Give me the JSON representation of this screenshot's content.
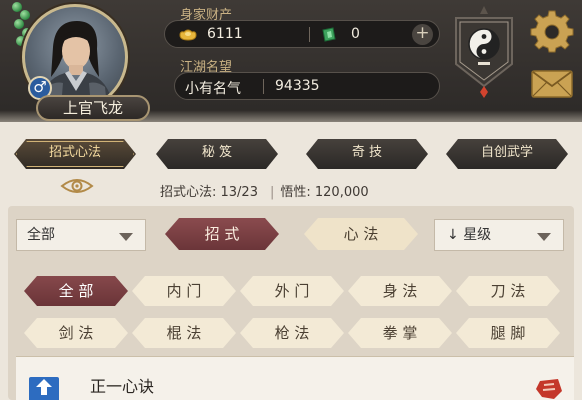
{
  "player": {
    "name": "上官飞龙",
    "gender_symbol": "♂"
  },
  "wealth": {
    "label": "身家财产",
    "gold": "6111",
    "jade": "0"
  },
  "fame": {
    "label": "江湖名望",
    "title": "小有名气",
    "value": "94335"
  },
  "categories": [
    {
      "label": "招式心法",
      "active": true
    },
    {
      "label": "秘 笈",
      "active": false
    },
    {
      "label": "奇 技",
      "active": false
    },
    {
      "label": "自创武学",
      "active": false
    }
  ],
  "stats": {
    "progress": "招式心法: 13/23",
    "insight": "悟性: 120,000"
  },
  "filters": {
    "scope": "全部",
    "sort": "星级",
    "segments": [
      {
        "label": "招 式",
        "active": true
      },
      {
        "label": "心 法",
        "active": false
      }
    ]
  },
  "chips": [
    {
      "label": "全 部",
      "active": true
    },
    {
      "label": "内 门",
      "active": false
    },
    {
      "label": "外 门",
      "active": false
    },
    {
      "label": "身 法",
      "active": false
    },
    {
      "label": "刀 法",
      "active": false
    },
    {
      "label": "剑 法",
      "active": false
    },
    {
      "label": "棍 法",
      "active": false
    },
    {
      "label": "枪 法",
      "active": false
    },
    {
      "label": "拳 掌",
      "active": false
    },
    {
      "label": "腿 脚",
      "active": false
    }
  ],
  "skills": [
    {
      "name": "正一心诀"
    }
  ],
  "icons": {
    "gold": "gold-ingot-icon",
    "jade": "jade-currency-icon",
    "sect": "taiji-emblem-icon",
    "settings": "gear-icon",
    "mail": "envelope-icon",
    "view": "eye-icon"
  },
  "colors": {
    "header_bg": "#2c2927",
    "accent_red": "#7a3d41",
    "chip_bg": "#f3ead6",
    "panel_bg": "#ddd4c6"
  }
}
